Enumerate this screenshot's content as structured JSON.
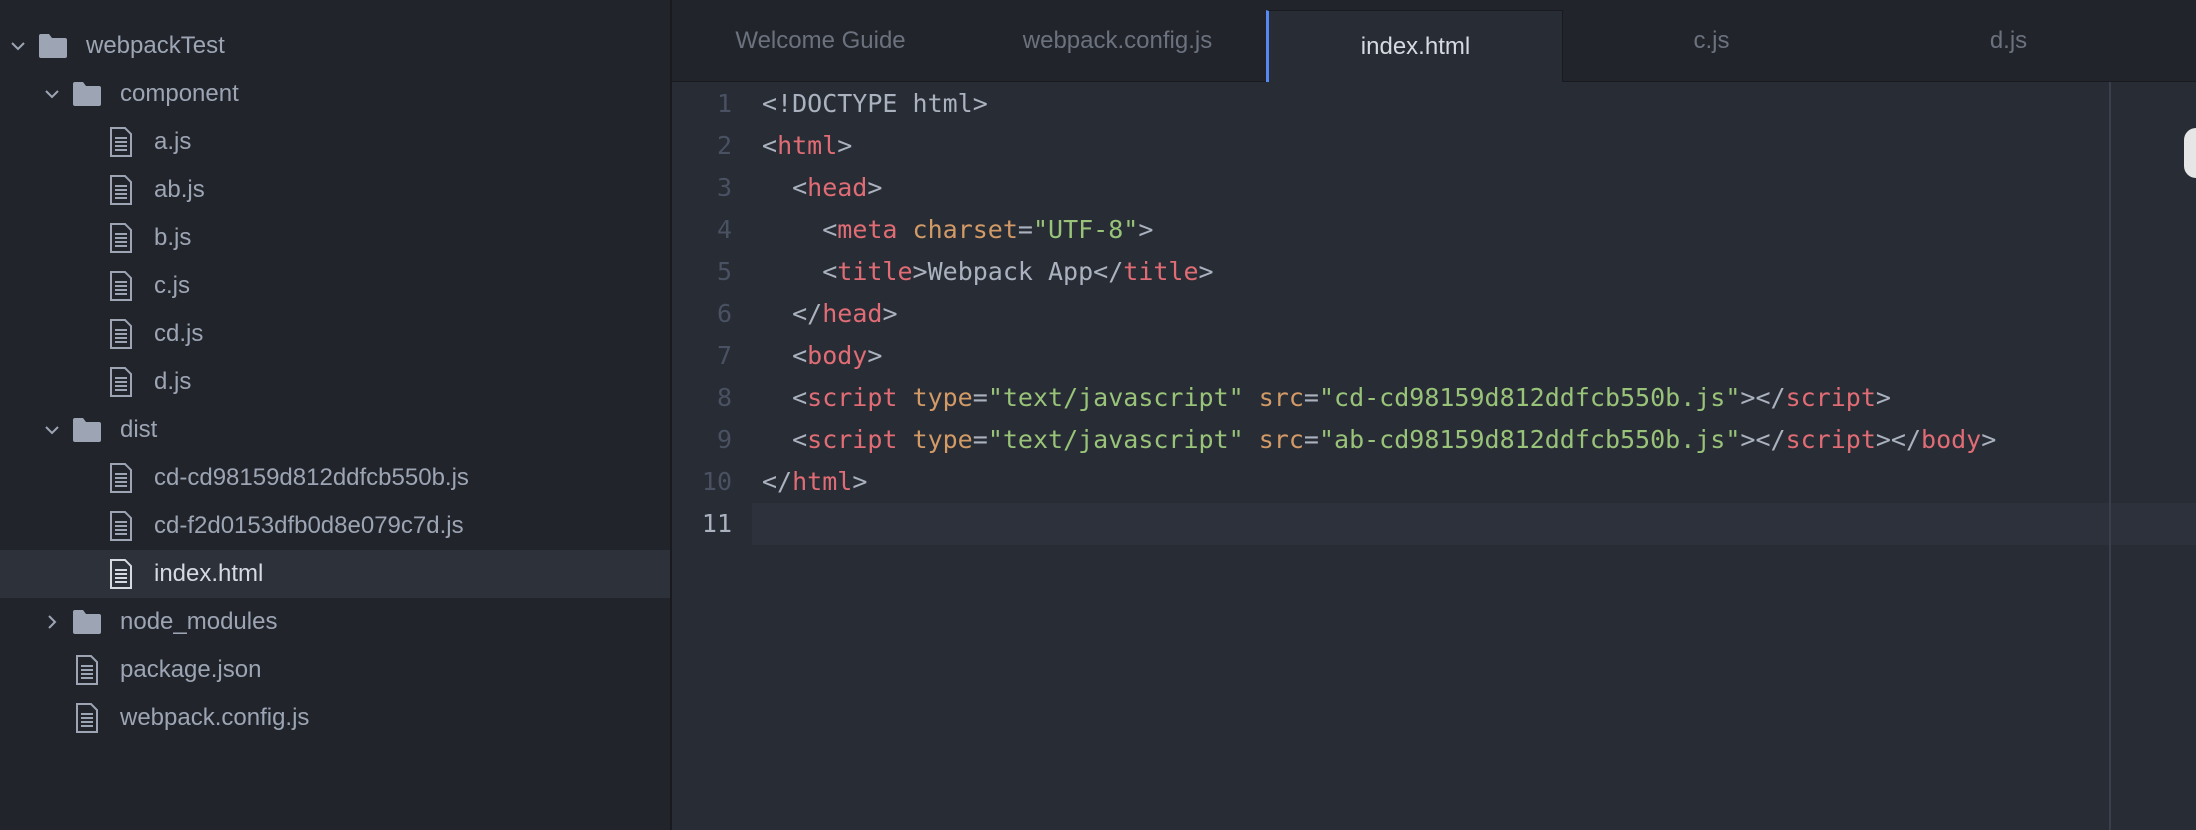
{
  "tree": {
    "root": {
      "label": "webpackTest",
      "expanded": true
    },
    "items": [
      {
        "label": "component",
        "type": "folder",
        "expanded": true
      },
      {
        "label": "a.js",
        "type": "file"
      },
      {
        "label": "ab.js",
        "type": "file"
      },
      {
        "label": "b.js",
        "type": "file"
      },
      {
        "label": "c.js",
        "type": "file"
      },
      {
        "label": "cd.js",
        "type": "file"
      },
      {
        "label": "d.js",
        "type": "file"
      },
      {
        "label": "dist",
        "type": "folder",
        "expanded": true
      },
      {
        "label": "cd-cd98159d812ddfcb550b.js",
        "type": "file"
      },
      {
        "label": "cd-f2d0153dfb0d8e079c7d.js",
        "type": "file"
      },
      {
        "label": "index.html",
        "type": "file",
        "selected": true
      },
      {
        "label": "node_modules",
        "type": "folder",
        "expanded": false
      },
      {
        "label": "package.json",
        "type": "file"
      },
      {
        "label": "webpack.config.js",
        "type": "file"
      }
    ]
  },
  "tabs": [
    {
      "label": "Welcome Guide"
    },
    {
      "label": "webpack.config.js"
    },
    {
      "label": "index.html",
      "active": true
    },
    {
      "label": "c.js"
    },
    {
      "label": "d.js"
    }
  ],
  "editor": {
    "line_numbers": [
      "1",
      "2",
      "3",
      "4",
      "5",
      "6",
      "7",
      "8",
      "9",
      "10",
      "11"
    ],
    "current_line": "11",
    "lines": [
      [
        {
          "t": "doc",
          "v": "<!DOCTYPE html>"
        }
      ],
      [
        {
          "t": "punc",
          "v": "<"
        },
        {
          "t": "tag",
          "v": "html"
        },
        {
          "t": "punc",
          "v": ">"
        }
      ],
      [
        {
          "t": "punc",
          "v": "  <"
        },
        {
          "t": "tag",
          "v": "head"
        },
        {
          "t": "punc",
          "v": ">"
        }
      ],
      [
        {
          "t": "punc",
          "v": "    <"
        },
        {
          "t": "tag",
          "v": "meta"
        },
        {
          "t": "punc",
          "v": " "
        },
        {
          "t": "attr",
          "v": "charset"
        },
        {
          "t": "punc",
          "v": "="
        },
        {
          "t": "str",
          "v": "\"UTF-8\""
        },
        {
          "t": "punc",
          "v": ">"
        }
      ],
      [
        {
          "t": "punc",
          "v": "    <"
        },
        {
          "t": "tag",
          "v": "title"
        },
        {
          "t": "punc",
          "v": ">"
        },
        {
          "t": "text",
          "v": "Webpack App"
        },
        {
          "t": "punc",
          "v": "</"
        },
        {
          "t": "tag",
          "v": "title"
        },
        {
          "t": "punc",
          "v": ">"
        }
      ],
      [
        {
          "t": "punc",
          "v": "  </"
        },
        {
          "t": "tag",
          "v": "head"
        },
        {
          "t": "punc",
          "v": ">"
        }
      ],
      [
        {
          "t": "punc",
          "v": "  <"
        },
        {
          "t": "tag",
          "v": "body"
        },
        {
          "t": "punc",
          "v": ">"
        }
      ],
      [
        {
          "t": "punc",
          "v": "  <"
        },
        {
          "t": "tag",
          "v": "script"
        },
        {
          "t": "punc",
          "v": " "
        },
        {
          "t": "attr",
          "v": "type"
        },
        {
          "t": "punc",
          "v": "="
        },
        {
          "t": "str",
          "v": "\"text/javascript\""
        },
        {
          "t": "punc",
          "v": " "
        },
        {
          "t": "attr",
          "v": "src"
        },
        {
          "t": "punc",
          "v": "="
        },
        {
          "t": "str",
          "v": "\"cd-cd98159d812ddfcb550b.js\""
        },
        {
          "t": "punc",
          "v": "></"
        },
        {
          "t": "tag",
          "v": "script"
        },
        {
          "t": "punc",
          "v": ">"
        }
      ],
      [
        {
          "t": "punc",
          "v": "  <"
        },
        {
          "t": "tag",
          "v": "script"
        },
        {
          "t": "punc",
          "v": " "
        },
        {
          "t": "attr",
          "v": "type"
        },
        {
          "t": "punc",
          "v": "="
        },
        {
          "t": "str",
          "v": "\"text/javascript\""
        },
        {
          "t": "punc",
          "v": " "
        },
        {
          "t": "attr",
          "v": "src"
        },
        {
          "t": "punc",
          "v": "="
        },
        {
          "t": "str",
          "v": "\"ab-cd98159d812ddfcb550b.js\""
        },
        {
          "t": "punc",
          "v": "></"
        },
        {
          "t": "tag",
          "v": "script"
        },
        {
          "t": "punc",
          "v": "></"
        },
        {
          "t": "tag",
          "v": "body"
        },
        {
          "t": "punc",
          "v": ">"
        }
      ],
      [
        {
          "t": "punc",
          "v": "</"
        },
        {
          "t": "tag",
          "v": "html"
        },
        {
          "t": "punc",
          "v": ">"
        }
      ],
      []
    ]
  },
  "colors": {
    "accent": "#568af2",
    "tag": "#e06c75",
    "attribute": "#d19a66",
    "string": "#98c379",
    "text": "#abb2bf"
  }
}
